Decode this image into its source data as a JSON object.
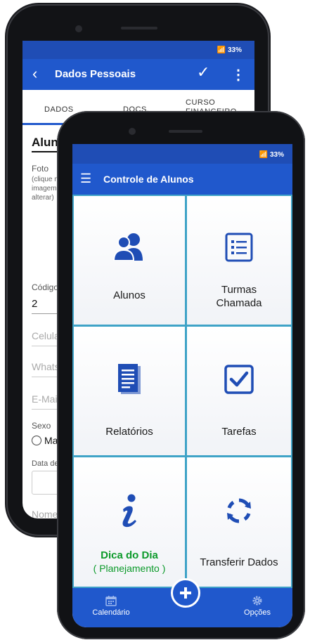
{
  "back_phone": {
    "status": {
      "battery": "33%"
    },
    "appbar": {
      "title": "Dados Pessoais"
    },
    "tabs": [
      {
        "label": "DADOS"
      },
      {
        "label": "DOCS."
      },
      {
        "label": "CURSO FINANCEIRO"
      }
    ],
    "form": {
      "section_title": "Aluno",
      "foto_label": "Foto",
      "foto_hint": "(clique n imagem alterar)",
      "codigo_label": "Código",
      "codigo_value": "2",
      "celular_placeholder": "Celula",
      "whatsapp_placeholder": "Whats",
      "email_placeholder": "E-Mai",
      "sexo_label": "Sexo",
      "sexo_option": "Ma",
      "data_label": "Data de",
      "nome_placeholder": "Nome"
    }
  },
  "front_phone": {
    "status": {
      "battery": "33%"
    },
    "appbar": {
      "title": "Controle de Alunos"
    },
    "tiles": {
      "alunos": "Alunos",
      "turmas": "Turmas",
      "chamada": "Chamada",
      "relatorios": "Relatórios",
      "tarefas": "Tarefas",
      "dica": "Dica do Dia",
      "planejamento": "( Planejamento )",
      "transferir": "Transferir Dados"
    },
    "bottom": {
      "calendario": "Calendário",
      "opcoes": "Opções"
    }
  },
  "colors": {
    "primary": "#2058cc",
    "status_bar": "#1f4db5",
    "divider": "#3fa3c7",
    "icon": "#1f4db5",
    "green": "#0c9a2a"
  }
}
